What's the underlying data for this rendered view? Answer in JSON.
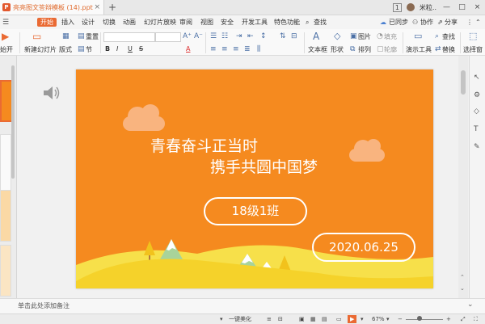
{
  "titlebar": {
    "doc_name": "亮亮图文答辩模板 (14).ppt",
    "close_tab": "×",
    "new_tab": "+",
    "badge": "1",
    "username": "米粒..",
    "minimize": "—",
    "maximize": "□",
    "close": "×"
  },
  "menubar": {
    "tabs": [
      "开始",
      "插入",
      "设计",
      "切换",
      "动画",
      "幻灯片放映",
      "审阅",
      "视图",
      "安全",
      "开发工具",
      "特色功能"
    ],
    "active_tab": "开始",
    "search_label": "查找",
    "sync_label": "已同步",
    "collab_label": "协作",
    "share_label": "分享"
  },
  "ribbon": {
    "play_label": "始开",
    "new_slide_label": "新建幻灯片",
    "layout_label": "版式",
    "reset_label": "重置",
    "section_label": "节",
    "textbox_label": "文本框",
    "shape_label": "形状",
    "arrange_label": "排列",
    "picture_label": "图片",
    "fill_label": "填充",
    "outline_label": "轮廓",
    "presenter_label": "演示工具",
    "find_label": "查找",
    "replace_label": "替换",
    "select_label": "选择窗",
    "bold": "B",
    "italic": "I",
    "underline": "U",
    "strike": "S",
    "font_color": "A"
  },
  "slide": {
    "title_line1": "青春奋斗正当时",
    "title_line2": "携手共圆中国梦",
    "class_label": "18级1班",
    "date_label": "2020.06.25"
  },
  "notes": {
    "placeholder": "单击此处添加备注"
  },
  "statusbar": {
    "beautify_label": "一键美化",
    "zoom": "67%",
    "zoom_minus": "−",
    "zoom_plus": "+"
  },
  "colors": {
    "accent": "#ea6a33",
    "slide_bg": "#f58a1f",
    "hill": "#f5d22a",
    "cloud": "#f9b47f"
  }
}
